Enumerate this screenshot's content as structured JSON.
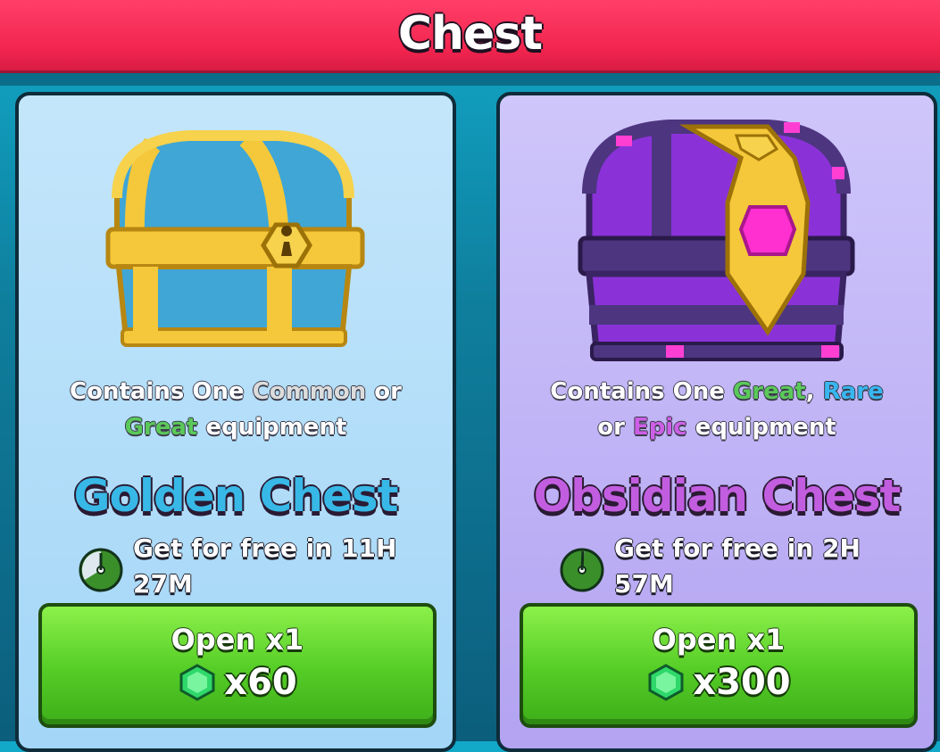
{
  "header": {
    "title": "Chest"
  },
  "cards": [
    {
      "desc_prefix": "Contains One",
      "desc_rarity1": "Common",
      "desc_sep1": "or",
      "desc_rarity2": "Great",
      "desc_suffix": "equipment",
      "name": "Golden Chest",
      "timer_line1": "Get for free in 11H",
      "timer_line2": "27M",
      "open_label": "Open x1",
      "cost": "x60"
    },
    {
      "desc_prefix": "Contains One",
      "desc_rarity1": "Great",
      "desc_sep1": ",",
      "desc_rarity2": "Rare",
      "desc_sep2": "or",
      "desc_rarity3": "Epic",
      "desc_suffix": "equipment",
      "name": "Obsidian Chest",
      "timer_line1": "Get for free in 2H",
      "timer_line2": "57M",
      "open_label": "Open x1",
      "cost": "x300"
    }
  ],
  "colors": {
    "header_bg": "#f2254f",
    "gold_card_bg": "#a3d6f7",
    "obsidian_card_bg": "#b3a3f1",
    "button_green": "#54cc26",
    "rarity_common": "#dcdcdc",
    "rarity_great": "#5bc95a",
    "rarity_rare": "#38b6f0",
    "rarity_epic": "#cc5fe6"
  },
  "icons": {
    "timer": "stopwatch-icon",
    "gem": "green-gem-icon",
    "golden_chest": "golden-chest-image",
    "obsidian_chest": "obsidian-chest-image"
  }
}
